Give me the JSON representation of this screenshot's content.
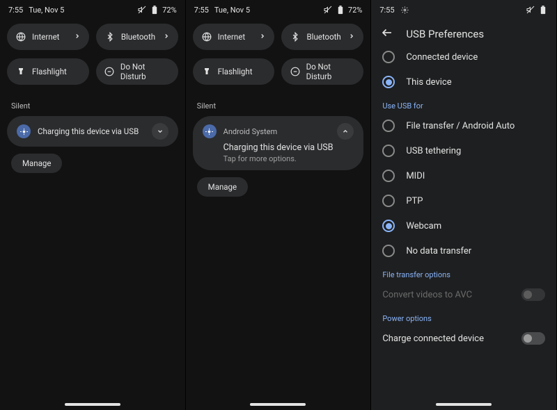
{
  "status": {
    "time": "7:55",
    "date": "Tue, Nov 5",
    "battery": "72%"
  },
  "qs": {
    "internet": "Internet",
    "bluetooth": "Bluetooth",
    "flashlight": "Flashlight",
    "dnd": "Do Not Disturb"
  },
  "section_silent": "Silent",
  "manage": "Manage",
  "pane1": {
    "notif_title": "Charging this device via USB"
  },
  "pane2": {
    "notif_app": "Android System",
    "notif_title": "Charging this device via USB",
    "notif_sub": "Tap for more options."
  },
  "pane3": {
    "title": "USB Preferences",
    "controlled_by_cut": "",
    "controlled": {
      "connected": "Connected device",
      "this": "This device"
    },
    "use_header": "Use USB for",
    "use": {
      "file": "File transfer / Android Auto",
      "tether": "USB tethering",
      "midi": "MIDI",
      "ptp": "PTP",
      "webcam": "Webcam",
      "none": "No data transfer"
    },
    "fto_header": "File transfer options",
    "convert": "Convert videos to AVC",
    "power_header": "Power options",
    "charge": "Charge connected device"
  }
}
